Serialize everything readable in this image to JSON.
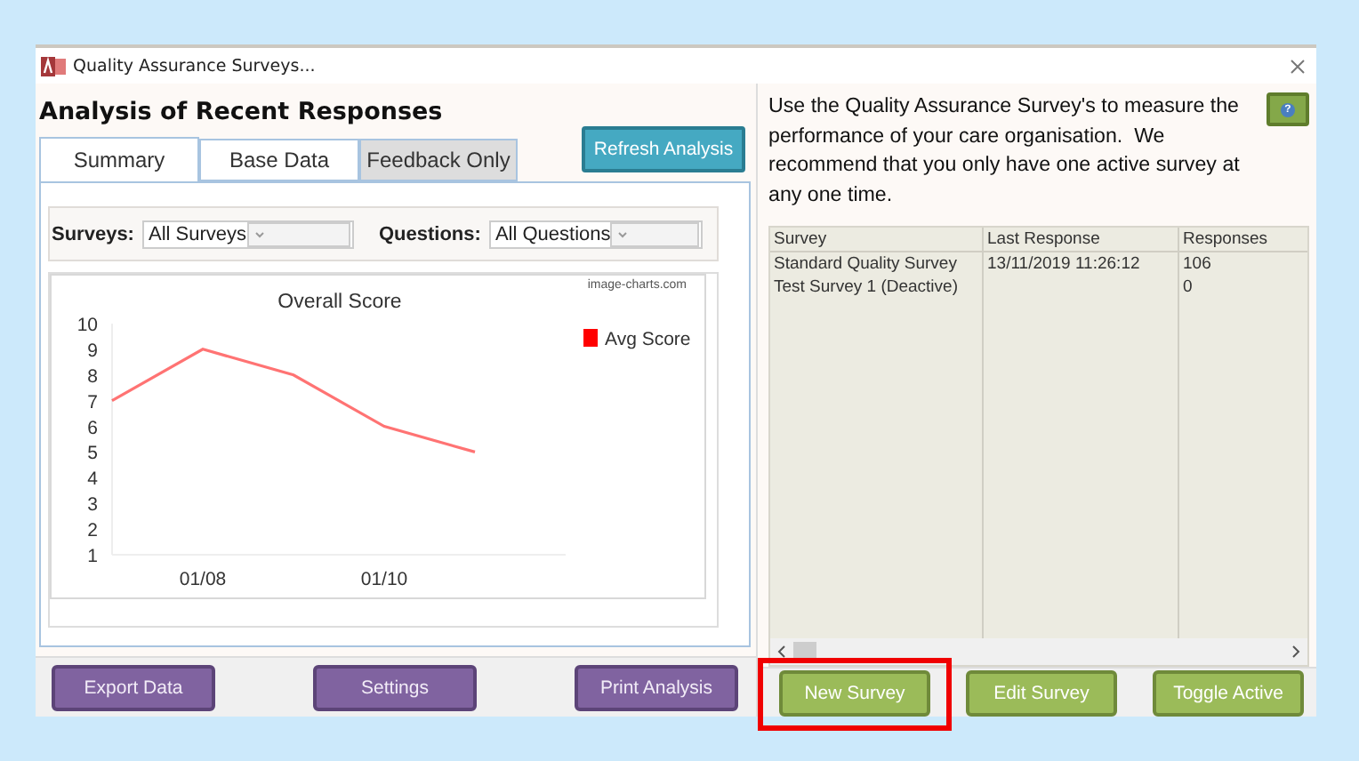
{
  "window": {
    "title": "Quality Assurance Surveys..."
  },
  "analysis": {
    "heading": "Analysis of Recent Responses",
    "tabs": [
      {
        "label": "Summary",
        "selected": true
      },
      {
        "label": "Base Data",
        "selected": false
      },
      {
        "label": "Feedback Only",
        "selected": false
      }
    ],
    "refresh_button": "Refresh Analysis",
    "filters": [
      {
        "label": "Surveys:",
        "value": "All Surveys"
      },
      {
        "label": "Questions:",
        "value": "All Questions"
      }
    ],
    "chart_credit": "image-charts.com",
    "chart_data": {
      "type": "line",
      "title": "Overall Score",
      "categories": [
        null,
        "01/08",
        null,
        "01/10",
        null
      ],
      "ylim": [
        1,
        10
      ],
      "yticks": [
        1,
        2,
        3,
        4,
        5,
        6,
        7,
        8,
        9,
        10
      ],
      "series": [
        {
          "name": "Avg Score",
          "color": "#ff0000",
          "values": [
            7,
            9,
            8,
            6,
            5
          ]
        }
      ]
    },
    "buttons": [
      "Export Data",
      "Settings",
      "Print Analysis"
    ]
  },
  "surveys": {
    "intro": "Use the Quality Assurance Survey's to measure the performance of your care organisation.  We recommend that you only have one active survey at any one time.",
    "help_button": "?",
    "columns": [
      "Survey",
      "Last Response",
      "Responses"
    ],
    "rows": [
      {
        "survey": "Standard Quality Survey",
        "last_response": "13/11/2019 11:26:12",
        "responses": "106"
      },
      {
        "survey": "Test Survey 1 (Deactive)",
        "responses": "0"
      }
    ],
    "buttons": [
      {
        "label": "New Survey",
        "highlighted": true
      },
      {
        "label": "Edit Survey",
        "highlighted": false
      },
      {
        "label": "Toggle Active",
        "highlighted": false
      }
    ]
  }
}
